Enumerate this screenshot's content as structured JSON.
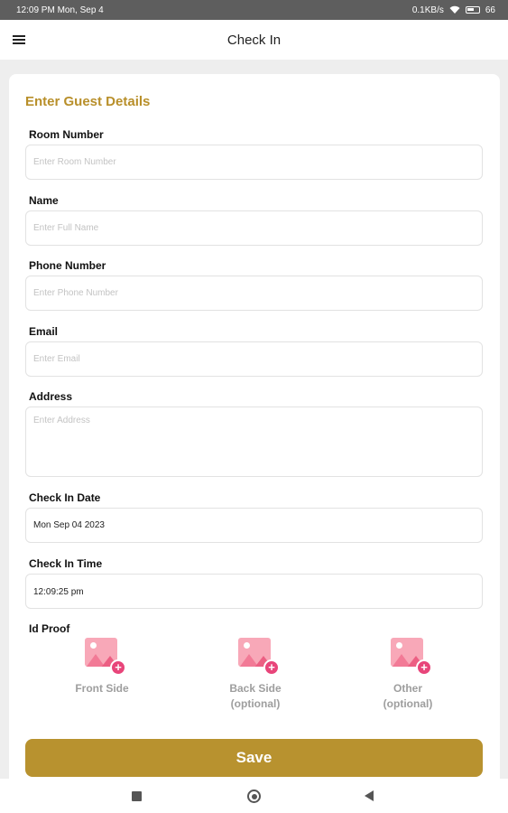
{
  "status_bar": {
    "time": "12:09 PM Mon, Sep 4",
    "network_speed": "0.1KB/s",
    "battery": "66"
  },
  "app_bar": {
    "title": "Check In",
    "menu_icon": "hamburger-menu-icon"
  },
  "form": {
    "section_title": "Enter Guest Details",
    "room_number": {
      "label": "Room Number",
      "placeholder": "Enter Room Number",
      "value": ""
    },
    "name": {
      "label": "Name",
      "placeholder": "Enter Full Name",
      "value": ""
    },
    "phone": {
      "label": "Phone Number",
      "placeholder": "Enter Phone Number",
      "value": ""
    },
    "email": {
      "label": "Email",
      "placeholder": "Enter Email",
      "value": ""
    },
    "address": {
      "label": "Address",
      "placeholder": "Enter Address",
      "value": ""
    },
    "check_in_date": {
      "label": "Check In Date",
      "value": "Mon Sep 04 2023"
    },
    "check_in_time": {
      "label": "Check In Time",
      "value": "12:09:25 pm"
    },
    "id_proof": {
      "label": "Id Proof",
      "items": [
        {
          "line1": "Front Side",
          "line2": ""
        },
        {
          "line1": "Back Side",
          "line2": "(optional)"
        },
        {
          "line1": "Other",
          "line2": "(optional)"
        }
      ]
    },
    "save_label": "Save"
  },
  "colors": {
    "accent": "#b8922f",
    "title_accent": "#b88f2a",
    "icon_pink": "#e8457a",
    "status_bar": "#5e5e5e"
  }
}
